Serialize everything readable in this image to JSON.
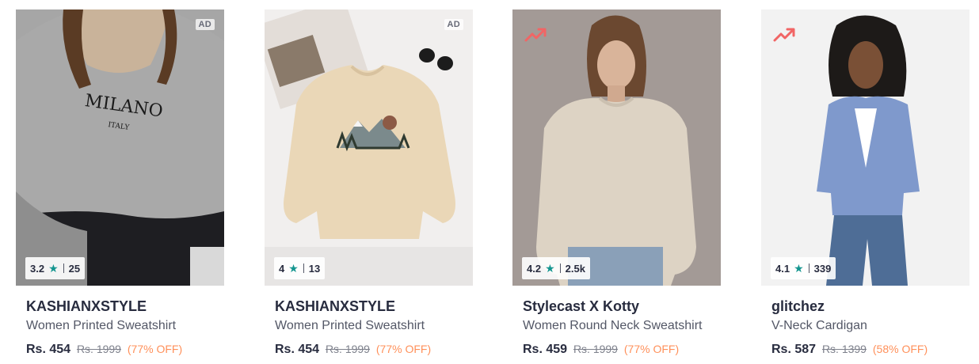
{
  "products": [
    {
      "brand": "KASHIANXSTYLE",
      "name": "Women Printed Sweatshirt",
      "price": "Rs. 454",
      "mrp": "Rs. 1999",
      "discount": "(77% OFF)",
      "rating": "3.2",
      "rating_count": "25",
      "badge": "AD",
      "print_text": "MILANO",
      "print_subtext": "ITALY"
    },
    {
      "brand": "KASHIANXSTYLE",
      "name": "Women Printed Sweatshirt",
      "price": "Rs. 454",
      "mrp": "Rs. 1999",
      "discount": "(77% OFF)",
      "rating": "4",
      "rating_count": "13",
      "badge": "AD"
    },
    {
      "brand": "Stylecast X Kotty",
      "name": "Women Round Neck Sweatshirt",
      "price": "Rs. 459",
      "mrp": "Rs. 1999",
      "discount": "(77% OFF)",
      "rating": "4.2",
      "rating_count": "2.5k",
      "badge_icon": "trending-icon"
    },
    {
      "brand": "glitchez",
      "name": "V-Neck Cardigan",
      "price": "Rs. 587",
      "mrp": "Rs. 1399",
      "discount": "(58% OFF)",
      "rating": "4.1",
      "rating_count": "339",
      "badge_icon": "trending-icon"
    }
  ],
  "colors": {
    "rating_star": "#14958f",
    "discount": "#ff905a",
    "trend": "#f16565"
  }
}
